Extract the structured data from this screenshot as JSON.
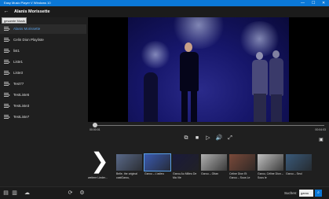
{
  "window": {
    "title": "Easy Music Player V Windows 10",
    "minimize": "—",
    "maximize": "☐",
    "close": "✕"
  },
  "header": {
    "back_icon": "←",
    "now_playing": "Alanis Morissette"
  },
  "tooltip": "gesamte Musik",
  "sidebar": {
    "items": [
      {
        "label": "Alanis Morissette",
        "active": true
      },
      {
        "label": "Celin Dion Playliste",
        "active": false
      },
      {
        "label": "list1",
        "active": false
      },
      {
        "label": "Liste1",
        "active": false
      },
      {
        "label": "Liste3",
        "active": false
      },
      {
        "label": "Test77",
        "active": false
      },
      {
        "label": "TestListe5",
        "active": false
      },
      {
        "label": "TestListe3",
        "active": false
      },
      {
        "label": "TestListe7",
        "active": false
      }
    ]
  },
  "player": {
    "current_time": "00:00:01",
    "end_time": "00:04:03",
    "progress": 0.01,
    "controls": {
      "pip_icon": "⧉",
      "stop_icon": "■",
      "play_icon": "▷",
      "volume_icon": "🔊",
      "fullscreen_icon": "⤢"
    }
  },
  "carousel": {
    "next_icon": "❯",
    "next_caption": "weitere Lieder...",
    "cards": [
      {
        "caption": "Belle, the original castGarou,",
        "selected": false,
        "tone": "#5a6a8a"
      },
      {
        "caption": "Garou – L'adieu",
        "selected": true,
        "tone": "#3a5ab0"
      },
      {
        "caption": "Garou Au Milieu De Ma Vie",
        "selected": false,
        "tone": "#1a1a3a"
      },
      {
        "caption": "Garou – Gitan",
        "selected": false,
        "tone": "#b0b0b0"
      },
      {
        "caption": "Celine Dion Et Garou – Sous Le",
        "selected": false,
        "tone": "#7a4a3a"
      },
      {
        "caption": "Garou, Céline Dion – Sous le",
        "selected": false,
        "tone": "#c0c0c0"
      },
      {
        "caption": "Garou – Seul",
        "selected": false,
        "tone": "#3a5a7a"
      }
    ]
  },
  "bottombar": {
    "search_label": "Suchen:",
    "search_value": "garou",
    "search_icon": "⌕"
  }
}
